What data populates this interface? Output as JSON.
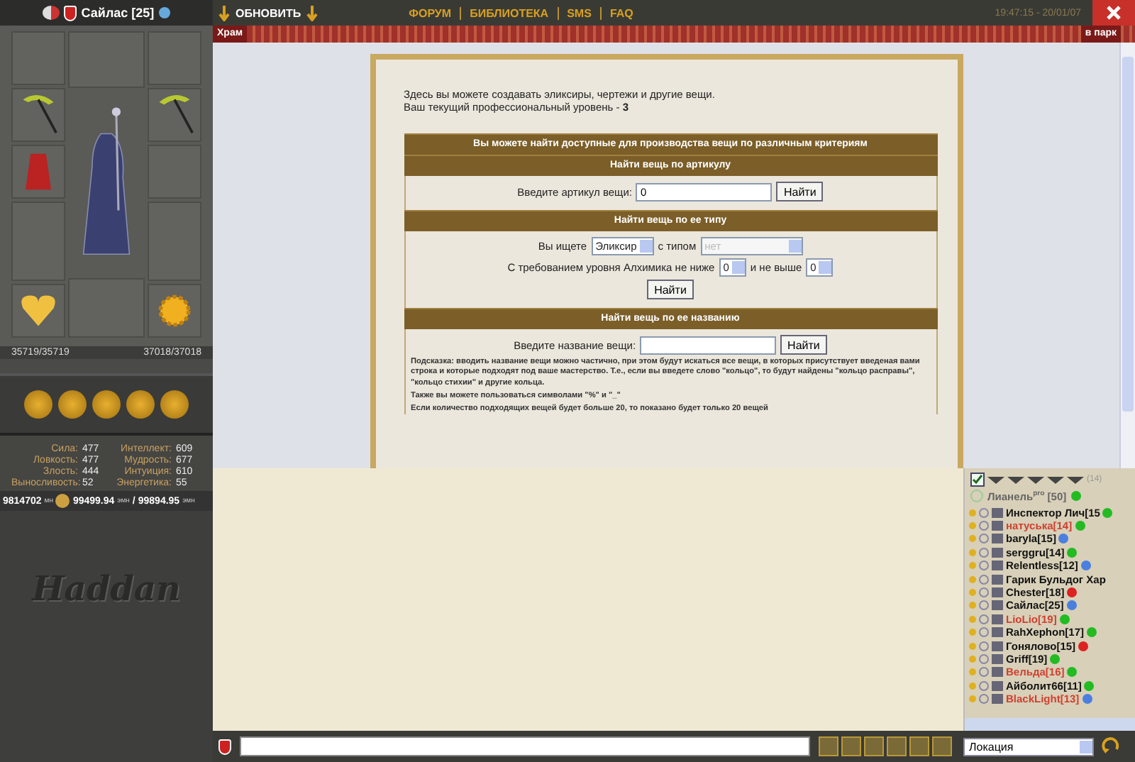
{
  "character": {
    "name": "Сайлас [25]",
    "hp": "35719/35719",
    "mana": "37018/37018"
  },
  "stats": [
    {
      "label": "Сила:",
      "value": "477"
    },
    {
      "label": "Интеллект:",
      "value": "609"
    },
    {
      "label": "Ловкость:",
      "value": "477"
    },
    {
      "label": "Мудрость:",
      "value": "677"
    },
    {
      "label": "Злость:",
      "value": "444"
    },
    {
      "label": "Интуиция:",
      "value": "610"
    },
    {
      "label": "Выносливость:",
      "value": "52"
    },
    {
      "label": "Энергетика:",
      "value": "55"
    }
  ],
  "money": {
    "coins": "9814702",
    "coins_unit": "мн",
    "balance": "99499.94",
    "balance_unit": "эмн",
    "separator": "/",
    "total": "99894.95",
    "total_unit": "эмн"
  },
  "logo": "Haddan",
  "top_bar": {
    "refresh": "ОБНОВИТЬ",
    "links": [
      "ФОРУМ",
      "БИБЛИОТЕКА",
      "SMS",
      "FAQ"
    ],
    "time": "19:47:15 - 20/01/07"
  },
  "location_bar": {
    "location": "Храм",
    "exit": "в парк"
  },
  "page": {
    "intro": "Здесь вы можете создавать эликсиры, чертежи и другие вещи.",
    "level_text": "Ваш текущий профессиональный уровень - **3**",
    "main_header": "Вы можете найти доступные для производства вещи по различным критериям",
    "by_article": {
      "header": "Найти вещь по артикулу",
      "label": "Введите артикул вещи:",
      "value": "0",
      "button": "Найти"
    },
    "by_type": {
      "header": "Найти вещь по ее типу",
      "label1": "Вы ищете",
      "type": "Эликсир",
      "label2": "с типом",
      "subtype": "нет",
      "subtype_disabled": true,
      "label3": "С требованием уровня Алхимика не ниже",
      "min": "0",
      "label4": "и не выше",
      "max": "0",
      "button": "Найти"
    },
    "by_name": {
      "header": "Найти вещь по ее названию",
      "label": "Введите название вещи:",
      "button": "Найти",
      "hints": [
        "Подсказка: вводить название вещи можно частично, при этом будут искаться все вещи, в которых присутствует введеная вами строка и которые подходят под ваше мастерство. Т.е., если вы введете слово \"кольцо\", то будут найдены \"кольцо расправы\", \"кольцо стихии\" и другие кольца.",
        "Также вы можете пользоваться символами \"%\" и \"_\"",
        "Если количество подходящих вещей будет больше 20, то показано будет только 20 вещей"
      ]
    }
  },
  "user_list": {
    "checked": true,
    "count": "(14)",
    "leader": {
      "name": "Лианель",
      "suffix": "pro",
      "level": "[50]",
      "color": "#22bb22"
    },
    "users": [
      {
        "name": "Инспектор Лич",
        "level": "[15",
        "highlighted": false,
        "color": "#22bb22"
      },
      {
        "name": "натуська",
        "level": "[14]",
        "highlighted": true,
        "color": "#22bb22"
      },
      {
        "name": "baryla",
        "level": "[15]",
        "highlighted": false,
        "color": "#4a7fe0"
      },
      {
        "name": "serggru",
        "level": "[14]",
        "highlighted": false,
        "color": "#22bb22"
      },
      {
        "name": "Relentless",
        "level": "[12]",
        "highlighted": false,
        "color": "#4a7fe0"
      },
      {
        "name": "Гарик Бульдог Хар",
        "highlighted": false
      },
      {
        "name": "Chester",
        "level": "[18]",
        "highlighted": false,
        "color": "#dd2222"
      },
      {
        "name": "Сайлас",
        "level": "[25]",
        "highlighted": false,
        "color": "#4a7fe0"
      },
      {
        "name": "LioLio",
        "level": "[19]",
        "highlighted": true,
        "color": "#22bb22"
      },
      {
        "name": "RahXephon",
        "level": "[17]",
        "highlighted": false,
        "color": "#22bb22"
      },
      {
        "name": "Гонялово",
        "level": "[15]",
        "highlighted": false,
        "color": "#dd2222"
      },
      {
        "name": "Griff",
        "level": "[19]",
        "highlighted": false,
        "color": "#22bb22"
      },
      {
        "name": "Вельда",
        "level": "[16]",
        "highlighted": true,
        "color": "#22bb22"
      },
      {
        "name": "Айболит66",
        "level": "[11]",
        "highlighted": false,
        "color": "#22bb22"
      },
      {
        "name": "BlackLight",
        "level": "[13]",
        "highlighted": true,
        "color": "#4a7fe0"
      }
    ]
  },
  "chat": {
    "location_select": "Локация"
  }
}
